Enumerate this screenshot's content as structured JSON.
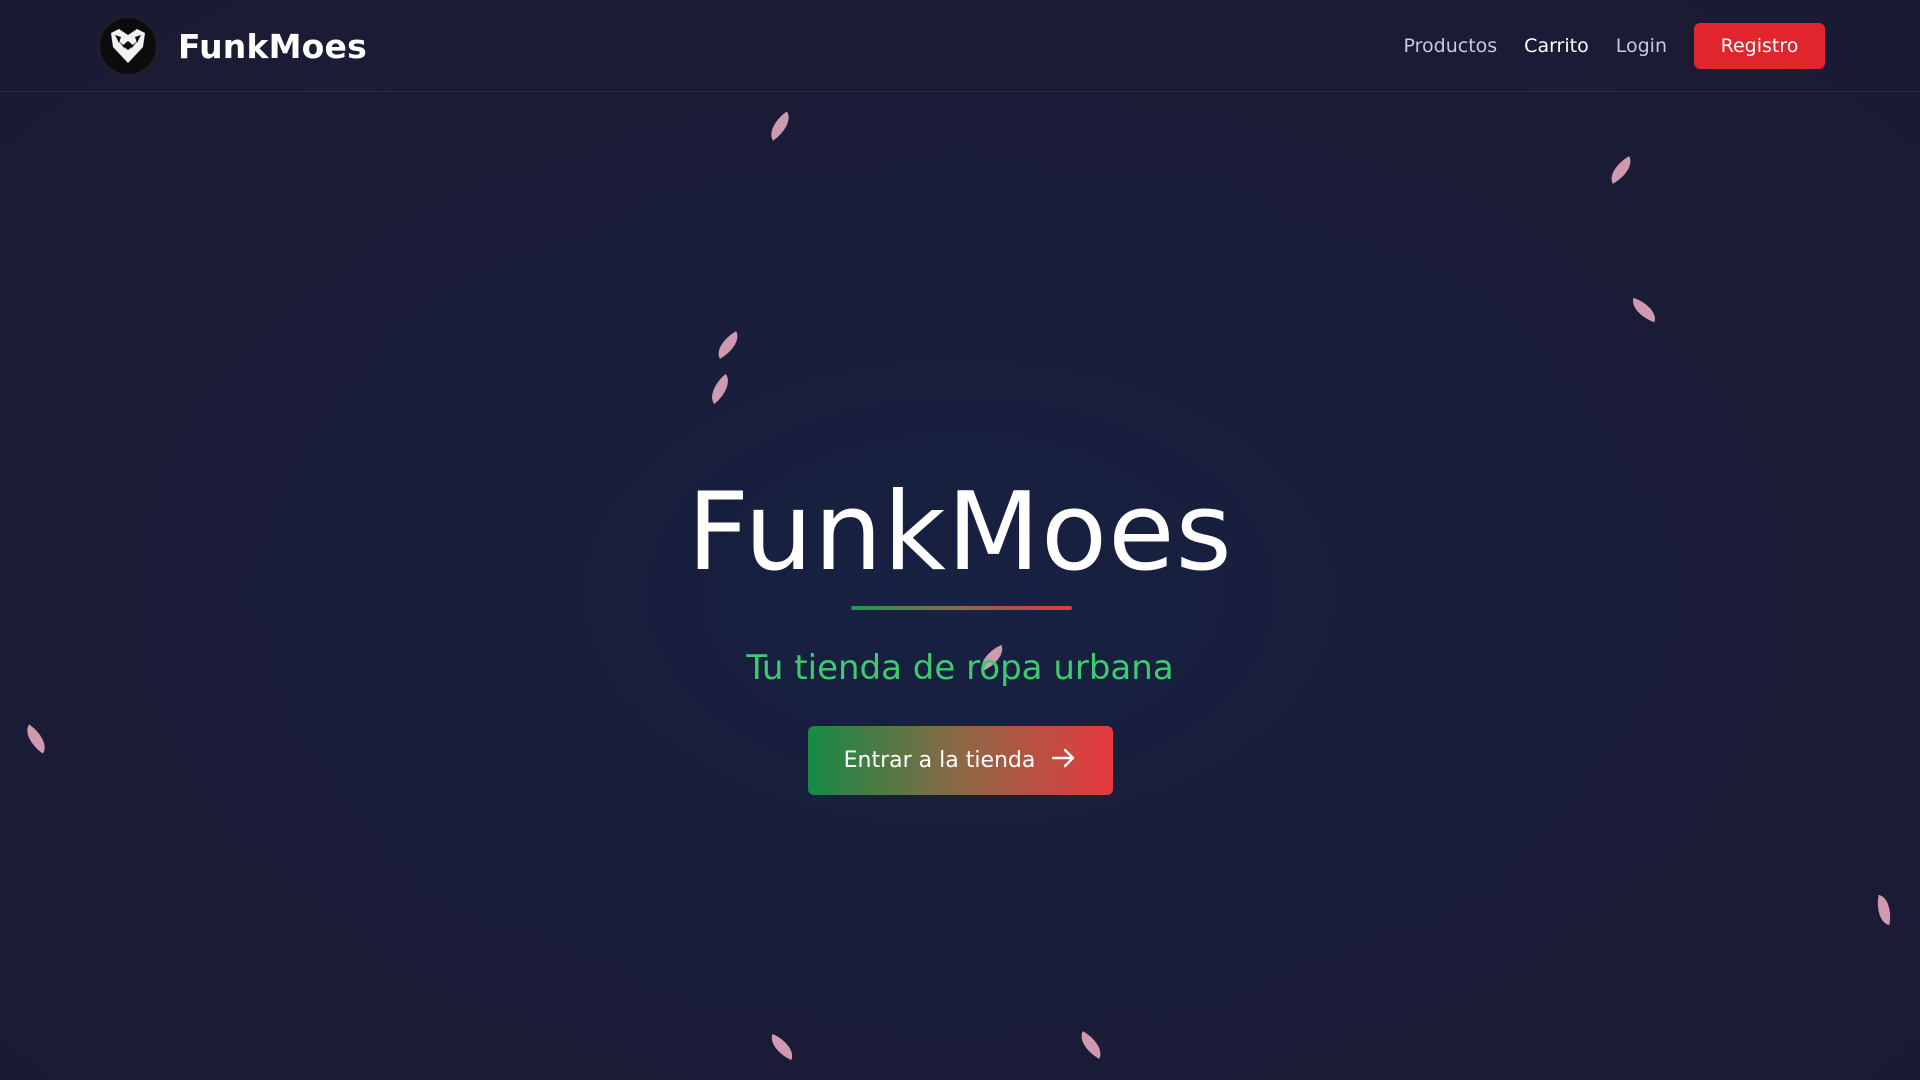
{
  "brand": {
    "name": "FunkMoes",
    "logo_icon": "wolf-head-logo-icon"
  },
  "nav": {
    "items": [
      {
        "label": "Productos",
        "active": false
      },
      {
        "label": "Carrito",
        "active": true
      },
      {
        "label": "Login",
        "active": false
      }
    ],
    "register_label": "Registro"
  },
  "hero": {
    "title": "FunkMoes",
    "tagline": "Tu tienda de ropa urbana",
    "cta_label": "Entrar a la tienda",
    "cta_icon": "arrow-right-icon"
  },
  "colors": {
    "background": "#1a1d38",
    "accent_red": "#e0262c",
    "accent_green": "#3ecb6e",
    "petal": "#d9a1b6"
  }
}
